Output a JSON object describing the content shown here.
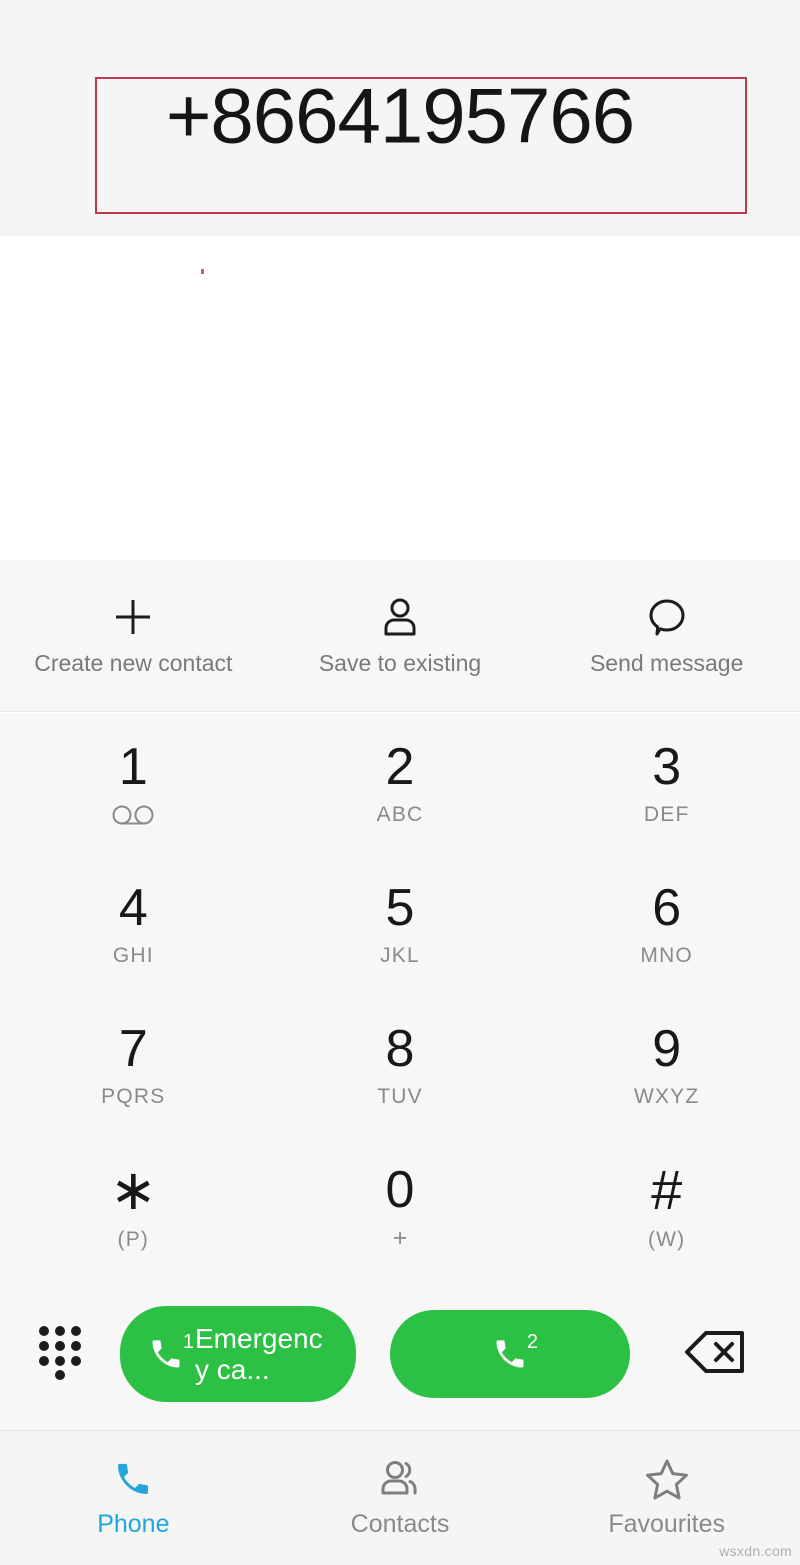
{
  "display": {
    "number": "+8664195766",
    "highlight_color": "#c0394a",
    "background": "#f5f5f5"
  },
  "actions": [
    {
      "label": "Create new contact",
      "icon": "plus-icon"
    },
    {
      "label": "Save to existing",
      "icon": "person-icon"
    },
    {
      "label": "Send message",
      "icon": "speech-bubble-icon"
    }
  ],
  "keypad": {
    "rows": [
      [
        {
          "digit": "1",
          "sub": "",
          "sub_icon": "voicemail-icon"
        },
        {
          "digit": "2",
          "sub": "ABC"
        },
        {
          "digit": "3",
          "sub": "DEF"
        }
      ],
      [
        {
          "digit": "4",
          "sub": "GHI"
        },
        {
          "digit": "5",
          "sub": "JKL"
        },
        {
          "digit": "6",
          "sub": "MNO"
        }
      ],
      [
        {
          "digit": "7",
          "sub": "PQRS"
        },
        {
          "digit": "8",
          "sub": "TUV"
        },
        {
          "digit": "9",
          "sub": "WXYZ"
        }
      ],
      [
        {
          "digit": "∗",
          "sub": "(P)"
        },
        {
          "digit": "0",
          "sub": "+"
        },
        {
          "digit": "#",
          "sub": "(W)"
        }
      ]
    ]
  },
  "call_bar": {
    "dialpad_toggle_icon": "dialpad-icon",
    "sim1": {
      "badge": "1",
      "label": "Emergency ca...",
      "color": "#2cc044"
    },
    "sim2": {
      "badge": "2",
      "label": "",
      "color": "#2cc044"
    },
    "backspace_icon": "backspace-icon"
  },
  "bottom_nav": {
    "active_color": "#23a6d8",
    "items": [
      {
        "label": "Phone",
        "icon": "phone-handset-icon",
        "active": true
      },
      {
        "label": "Contacts",
        "icon": "contacts-icon",
        "active": false
      },
      {
        "label": "Favourites",
        "icon": "star-icon",
        "active": false
      }
    ]
  },
  "watermark": "wsxdn.com"
}
